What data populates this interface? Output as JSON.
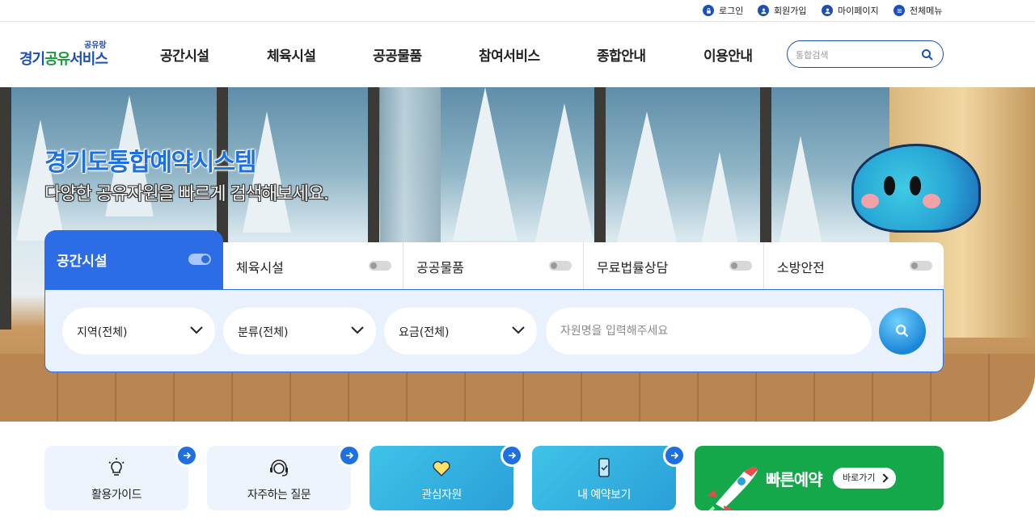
{
  "utility": {
    "login": "로그인",
    "signup": "회원가입",
    "mypage": "마이페이지",
    "allmenu": "전체메뉴"
  },
  "logo": {
    "small": "공유랑",
    "main_a": "경기",
    "main_b": "공유",
    "main_c": "서비스"
  },
  "gnb": [
    "공간시설",
    "체육시설",
    "공공물품",
    "참여서비스",
    "종합안내",
    "이용안내"
  ],
  "header_search": {
    "placeholder": "통합검색"
  },
  "hero": {
    "title": "경기도통합예약시스템",
    "subtitle": "다양한 공유자원을 빠르게 검색해보세요."
  },
  "tabs": {
    "active": "공간시설",
    "items": [
      "체육시설",
      "공공물품",
      "무료법률상담",
      "소방안전"
    ]
  },
  "filters": {
    "region": "지역(전체)",
    "category": "분류(전체)",
    "fee": "요금(전체)",
    "keyword_placeholder": "자원명을 입력해주세요"
  },
  "quick_links": {
    "guide": "활용가이드",
    "faq": "자주하는 질문",
    "favorites": "관심자원",
    "my_reservations": "내 예약보기",
    "fast_reservation": "빠른예약",
    "go_now": "바로가기"
  },
  "colors": {
    "primary": "#1e4fb8",
    "accent": "#2c6de6",
    "green": "#14a84a",
    "cyan": "#2a9fd8"
  }
}
